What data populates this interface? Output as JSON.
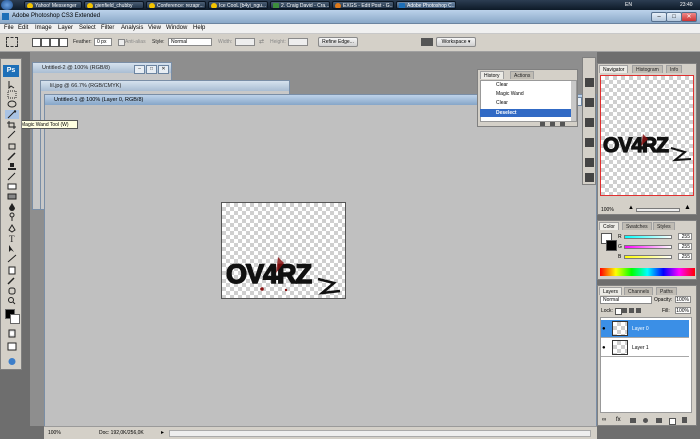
{
  "taskbar": {
    "items": [
      {
        "label": "Yahoo! Messenger"
      },
      {
        "label": "gienfield_chubby"
      },
      {
        "label": "Conference: rezapr..."
      },
      {
        "label": "Ice CooL [b4yi_ngu..."
      },
      {
        "label": "2. Craig David - Cra..."
      },
      {
        "label": "EXGS - Edit Post - G..."
      },
      {
        "label": "Adobe Photoshop C..."
      }
    ],
    "lang": "EN",
    "clock": "23:40"
  },
  "window": {
    "title": "Adobe Photoshop CS3 Extended"
  },
  "menu": [
    "File",
    "Edit",
    "Image",
    "Layer",
    "Select",
    "Filter",
    "Analysis",
    "View",
    "Window",
    "Help"
  ],
  "options": {
    "feather_label": "Feather:",
    "feather_value": "0 px",
    "antialias_label": "Anti-alias",
    "style_label": "Style:",
    "style_value": "Normal",
    "width_label": "Width:",
    "height_label": "Height:",
    "refine_edge": "Refine Edge...",
    "workspace": "Workspace ▾"
  },
  "tooltip": "Magic Wand Tool (W)",
  "toolbox": {
    "logo": "Ps"
  },
  "documents": [
    {
      "title": "Untitled-2 @ 100% (RGB/8)"
    },
    {
      "title": "lil.jpg @ 66.7% (RGB/CMYK)"
    },
    {
      "title": "Untitled-1 @ 100% (Layer 0, RGB/8)"
    }
  ],
  "canvas_art": {
    "text": "OV4RZ"
  },
  "history": {
    "tabs": [
      "History",
      "Actions"
    ],
    "items": [
      "Clear",
      "Magic Wand",
      "Clear",
      "Deselect"
    ],
    "selected_index": 3
  },
  "navigator": {
    "tabs": [
      "Navigator",
      "Histogram",
      "Info"
    ],
    "zoom": "100%"
  },
  "color": {
    "tabs": [
      "Color",
      "Swatches",
      "Styles"
    ],
    "channels": [
      {
        "label": "R",
        "value": "255"
      },
      {
        "label": "G",
        "value": "255"
      },
      {
        "label": "B",
        "value": "255"
      }
    ]
  },
  "layers": {
    "tabs": [
      "Layers",
      "Channels",
      "Paths"
    ],
    "blend_mode": "Normal",
    "opacity_label": "Opacity:",
    "opacity_value": "100%",
    "lock_label": "Lock:",
    "fill_label": "Fill:",
    "fill_value": "100%",
    "items": [
      "Layer 0",
      "Layer 1"
    ],
    "selected_index": 0
  },
  "status": {
    "zoom": "100%",
    "doc": "Doc: 192,0K/256,0K"
  },
  "colors": {
    "taskbar": "#1d2c3e",
    "selection": "#316ac5",
    "layer_selected": "#3b8fe6",
    "art_red": "#8a1010"
  }
}
